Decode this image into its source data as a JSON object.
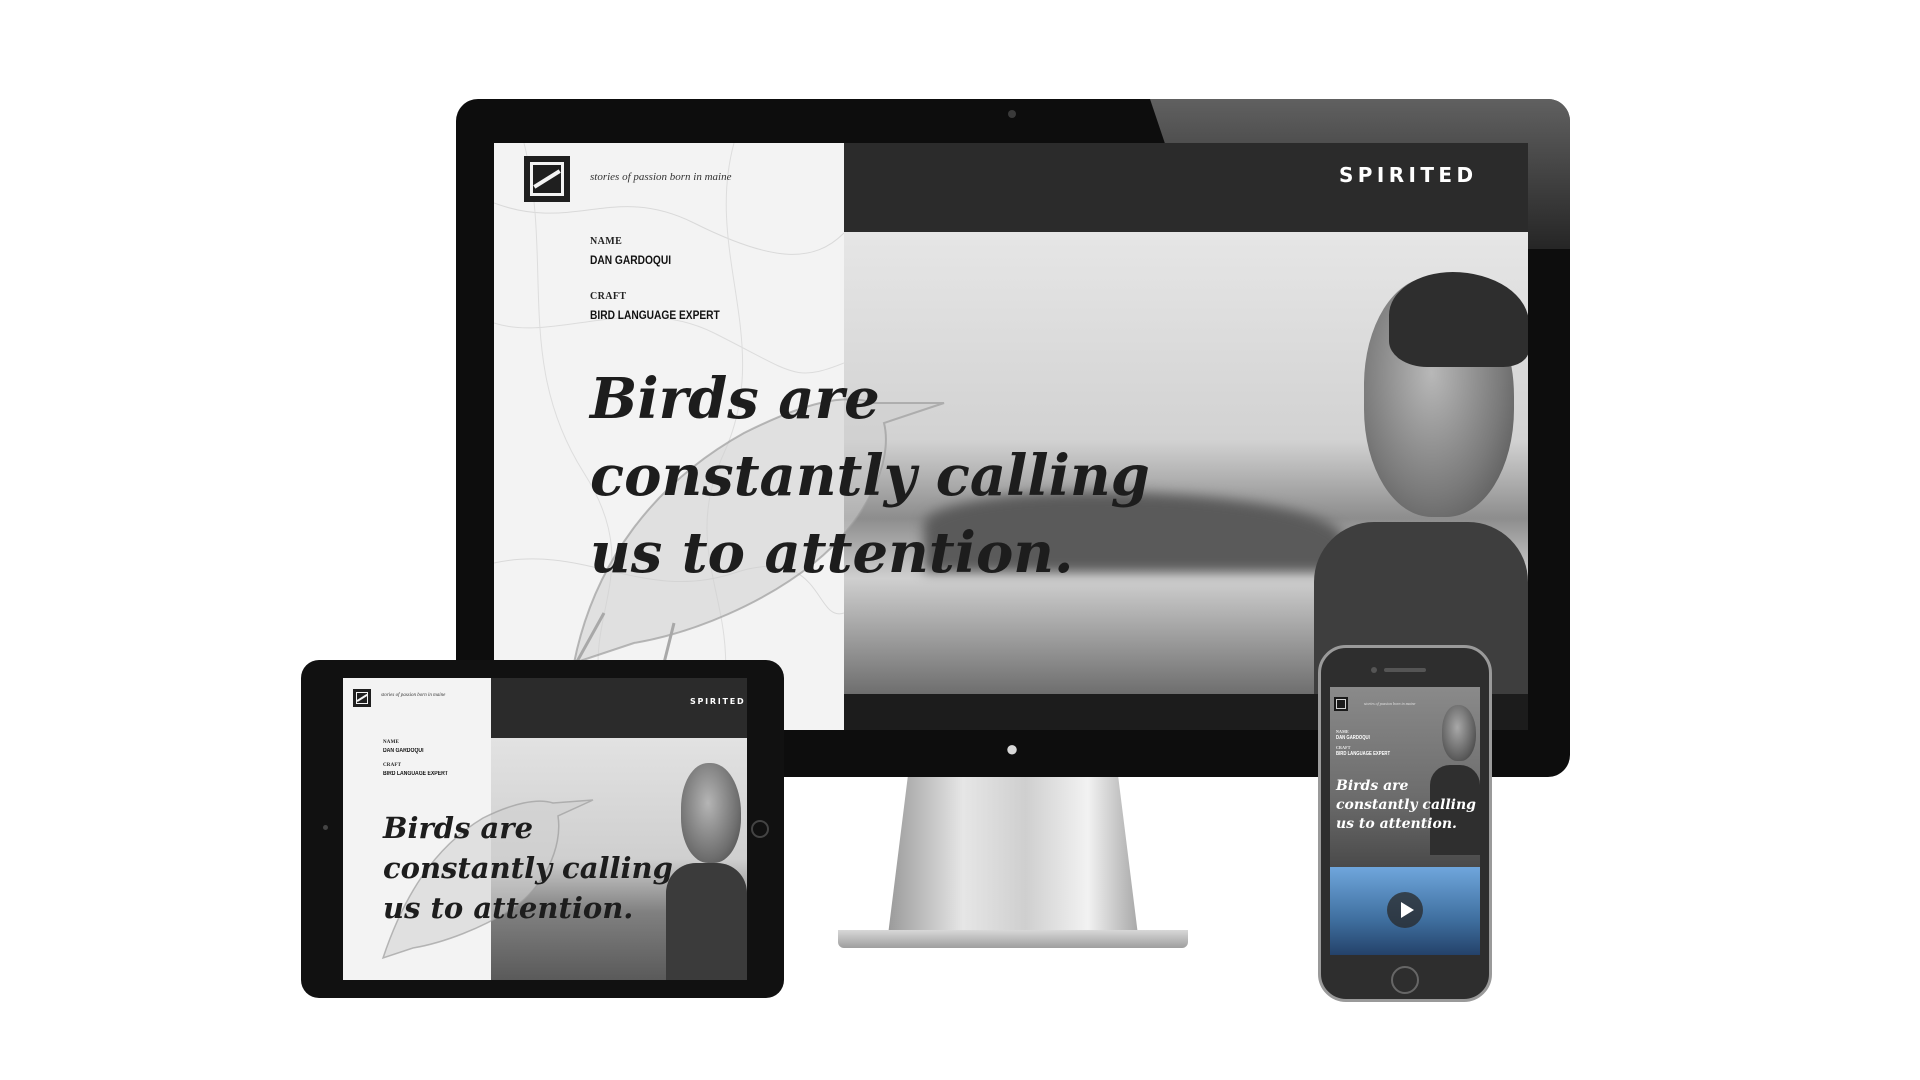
{
  "site": {
    "brand": "SPIRITED",
    "tagline": "stories of passion born in maine",
    "name_label": "NAME",
    "name_value": "DAN GARDOQUI",
    "craft_label": "CRAFT",
    "craft_value": "BIRD LANGUAGE EXPERT",
    "headline": [
      "Birds are",
      "constantly calling",
      "us to attention."
    ]
  },
  "icons": {
    "logo": "s-logo-icon",
    "apple": "apple-logo-icon",
    "play": "play-icon",
    "camera": "camera-icon",
    "home_button": "home-button-icon"
  },
  "colors": {
    "dark_bar": "#2b2b2b",
    "panel": "#f3f3f3",
    "text": "#1d1d1d",
    "video_blue": "#4a7fb5"
  }
}
